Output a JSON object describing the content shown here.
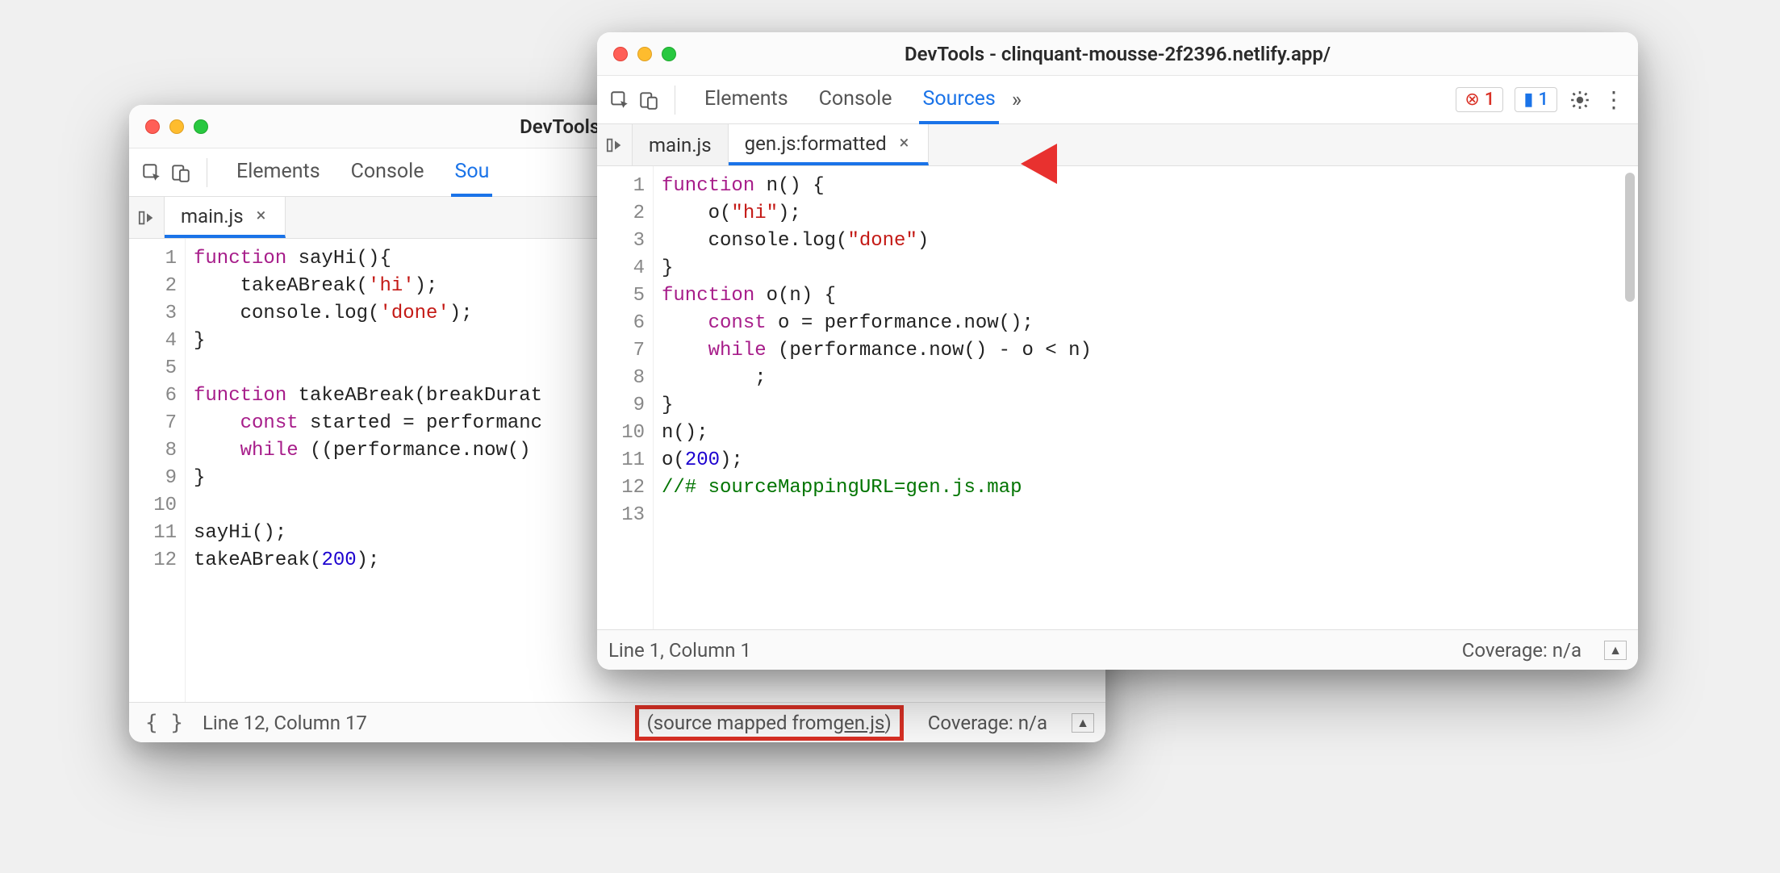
{
  "left": {
    "title": "DevTools - clinquant-n",
    "panels": [
      "Elements",
      "Console",
      "Sou"
    ],
    "activePanel": 2,
    "tabs": [
      {
        "label": "main.js",
        "active": true
      }
    ],
    "code_lines": [
      {
        "n": 1,
        "html": "<span class=\"kw\">function</span> sayHi(){"
      },
      {
        "n": 2,
        "html": "    takeABreak(<span class=\"str\">'hi'</span>);"
      },
      {
        "n": 3,
        "html": "    console.log(<span class=\"str\">'done'</span>);"
      },
      {
        "n": 4,
        "html": "}"
      },
      {
        "n": 5,
        "html": ""
      },
      {
        "n": 6,
        "html": "<span class=\"kw\">function</span> takeABreak(breakDurat"
      },
      {
        "n": 7,
        "html": "    <span class=\"kw\">const</span> started = performanc"
      },
      {
        "n": 8,
        "html": "    <span class=\"kw\">while</span> ((performance.now()"
      },
      {
        "n": 9,
        "html": "}"
      },
      {
        "n": 10,
        "html": ""
      },
      {
        "n": 11,
        "html": "sayHi();"
      },
      {
        "n": 12,
        "html": "takeABreak(<span class=\"num\">200</span>);"
      }
    ],
    "status": {
      "pos": "Line 12, Column 17",
      "mapped_prefix": "(source mapped from ",
      "mapped_link": "gen.js",
      "mapped_suffix": ")",
      "coverage": "Coverage: n/a"
    }
  },
  "right": {
    "title": "DevTools - clinquant-mousse-2f2396.netlify.app/",
    "panels": [
      "Elements",
      "Console",
      "Sources"
    ],
    "activePanel": 2,
    "err_count": "1",
    "info_count": "1",
    "tabs": [
      {
        "label": "main.js",
        "active": false
      },
      {
        "label": "gen.js:formatted",
        "active": true
      }
    ],
    "code_lines": [
      {
        "n": 1,
        "html": "<span class=\"kw\">function</span> n() {"
      },
      {
        "n": 2,
        "html": "    o(<span class=\"str\">\"hi\"</span>);"
      },
      {
        "n": 3,
        "html": "    console.log(<span class=\"str\">\"done\"</span>)"
      },
      {
        "n": 4,
        "html": "}"
      },
      {
        "n": 5,
        "html": "<span class=\"kw\">function</span> o(n) {"
      },
      {
        "n": 6,
        "html": "    <span class=\"kw\">const</span> o = performance.now();"
      },
      {
        "n": 7,
        "html": "    <span class=\"kw\">while</span> (performance.now() - o &lt; n)"
      },
      {
        "n": 8,
        "html": "        ;"
      },
      {
        "n": 9,
        "html": "}"
      },
      {
        "n": 10,
        "html": "n();"
      },
      {
        "n": 11,
        "html": "o(<span class=\"num\">200</span>);"
      },
      {
        "n": 12,
        "html": "<span class=\"cm\">//# sourceMappingURL=gen.js.map</span>"
      },
      {
        "n": 13,
        "html": ""
      }
    ],
    "status": {
      "pos": "Line 1, Column 1",
      "coverage": "Coverage: n/a"
    }
  }
}
